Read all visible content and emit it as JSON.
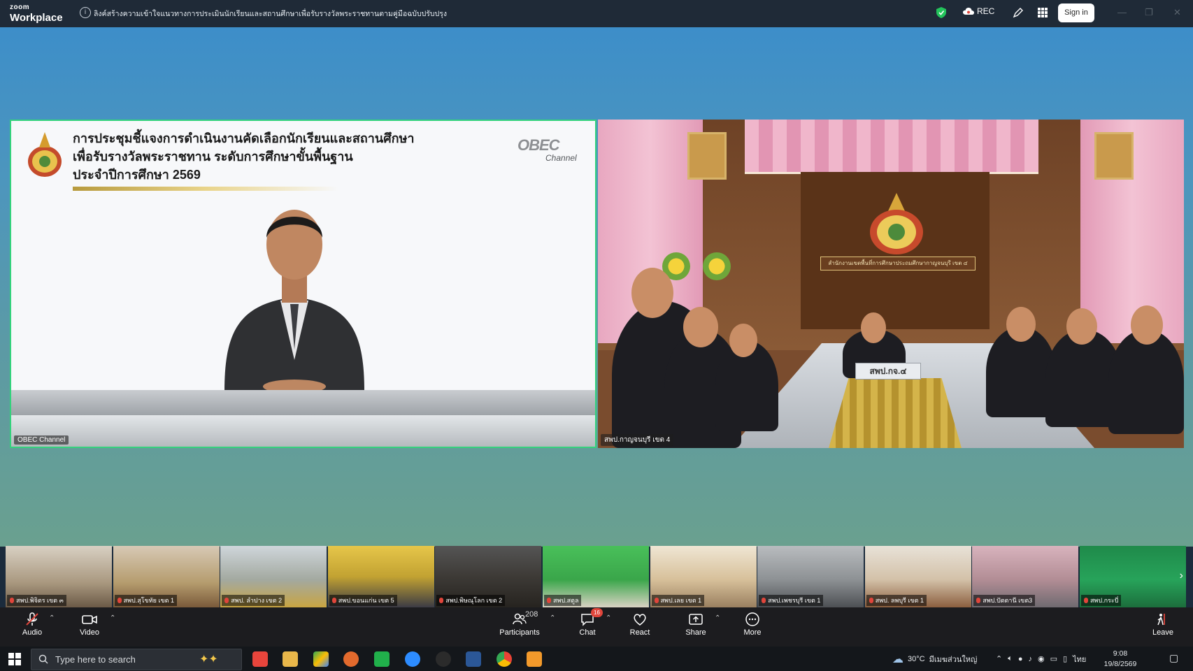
{
  "window": {
    "app_brand_small": "zoom",
    "app_brand": "Workplace",
    "meeting_topic": "ลิงค์สร้างความเข้าใจแนวทางการประเมินนักเรียนและสถานศึกษาเพื่อรับรางวัลพระราชทานตามคู่มือฉบับปรับปรุง",
    "rec_label": "REC",
    "sign_in_label": "Sign in"
  },
  "main_tiles": [
    {
      "slide_title_lines": [
        "การประชุมชี้แจงการดำเนินงานคัดเลือกนักเรียนและสถานศึกษา",
        "เพื่อรับรางวัลพระราชทาน ระดับการศึกษาขั้นพื้นฐาน",
        "ประจำปีการศึกษา 2569"
      ],
      "channel_logo_top": "OBEC",
      "channel_logo_bottom": "Channel",
      "participant_name": "OBEC Channel"
    },
    {
      "room_placard": "สำนักงานเขตพื้นที่การศึกษาประถมศึกษากาญจนบุรี เขต ๔",
      "desk_sign": "สพป.กจ.๔",
      "participant_name": "สพป.กาญจนบุรี เขต 4"
    }
  ],
  "thumbnails": [
    {
      "label": "สพป.พิจิตร เขต ๓"
    },
    {
      "label": "สพป.สุโขทัย เขต 1"
    },
    {
      "label": "สพป. ลำปาง เขต 2"
    },
    {
      "label": "สพป.ขอนแก่น เขต 5"
    },
    {
      "label": "สพป.พิษณุโลก เขต 2"
    },
    {
      "label": "สพป.สตูล"
    },
    {
      "label": "สพป.เลย เขต 1"
    },
    {
      "label": "สพป.เพชรบุรี เขต 1"
    },
    {
      "label": "สพป. ลพบุรี เขต 1"
    },
    {
      "label": "สพป.ปัตตานี เขต3"
    },
    {
      "label": "สพป.กระบี่"
    }
  ],
  "toolbar": {
    "audio_label": "Audio",
    "video_label": "Video",
    "participants_label": "Participants",
    "participants_count": "208",
    "chat_label": "Chat",
    "chat_badge": "16",
    "react_label": "React",
    "share_label": "Share",
    "more_label": "More",
    "leave_label": "Leave"
  },
  "taskbar": {
    "search_placeholder": "Type here to search",
    "weather_temp": "30°C",
    "weather_text": "มีเมฆส่วนใหญ่",
    "language": "ไทย",
    "time": "9:08",
    "date": "19/8/2569"
  },
  "colors": {
    "active_speaker_border": "#34d27c",
    "leave_red": "#e0453b",
    "toolbar_bg": "#1c1c1f"
  }
}
